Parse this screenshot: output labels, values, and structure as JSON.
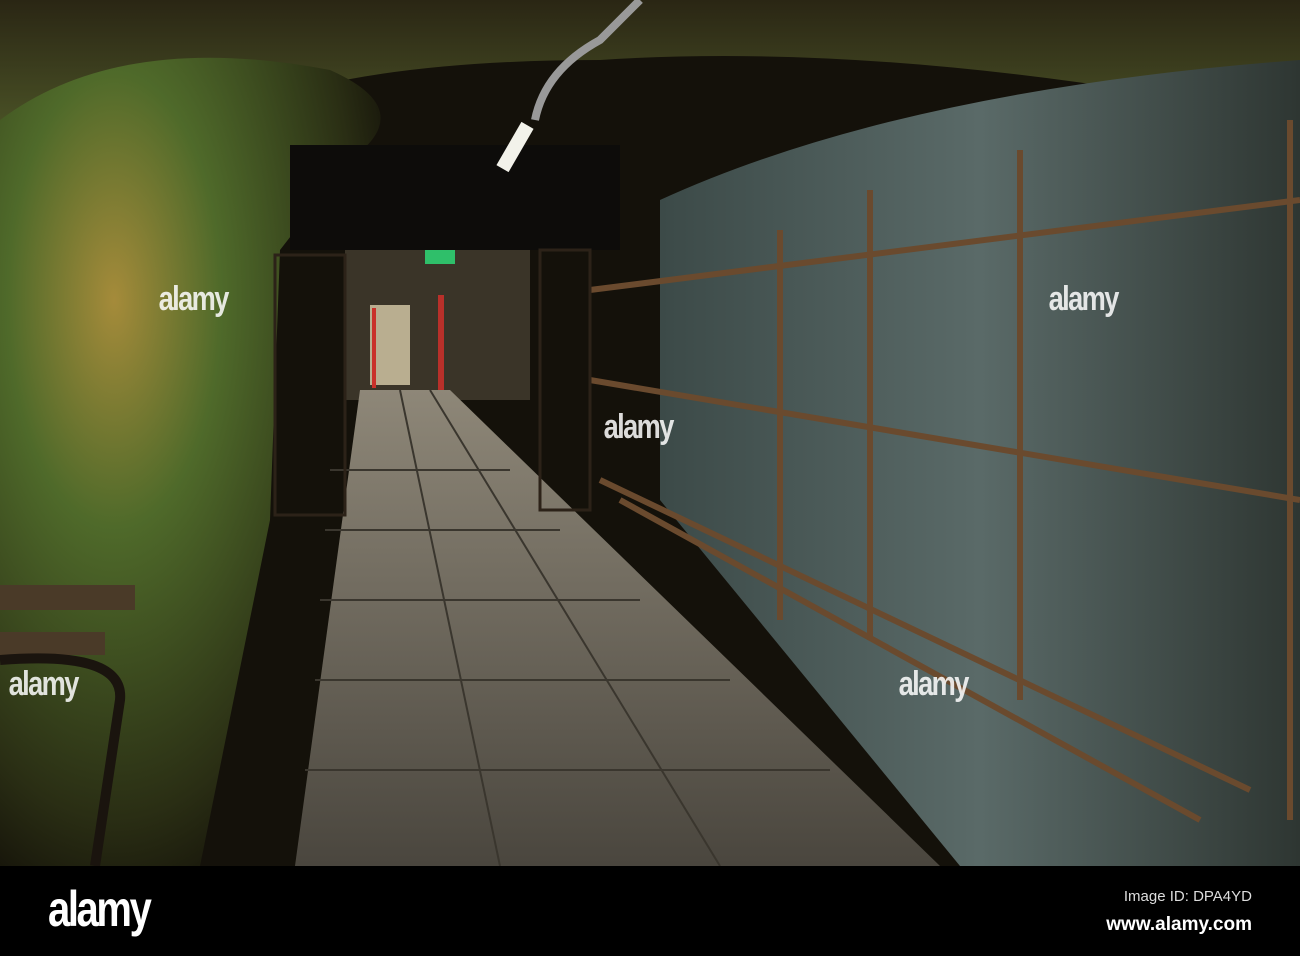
{
  "photo": {
    "subject": "underground tunnel corridor with bunk frames"
  },
  "signage": {
    "exit_sign": "exit"
  },
  "watermark": {
    "text": "alamy"
  },
  "footer": {
    "brand": "alamy",
    "image_id": "Image ID: DPA4YD",
    "website": "www.alamy.com"
  },
  "colors": {
    "wall_yellow": "#8a7a2a",
    "wall_green": "#3f5a22",
    "floor": "#6b6456",
    "rust": "#5a3a22",
    "exit_green": "#2fbf6a"
  }
}
